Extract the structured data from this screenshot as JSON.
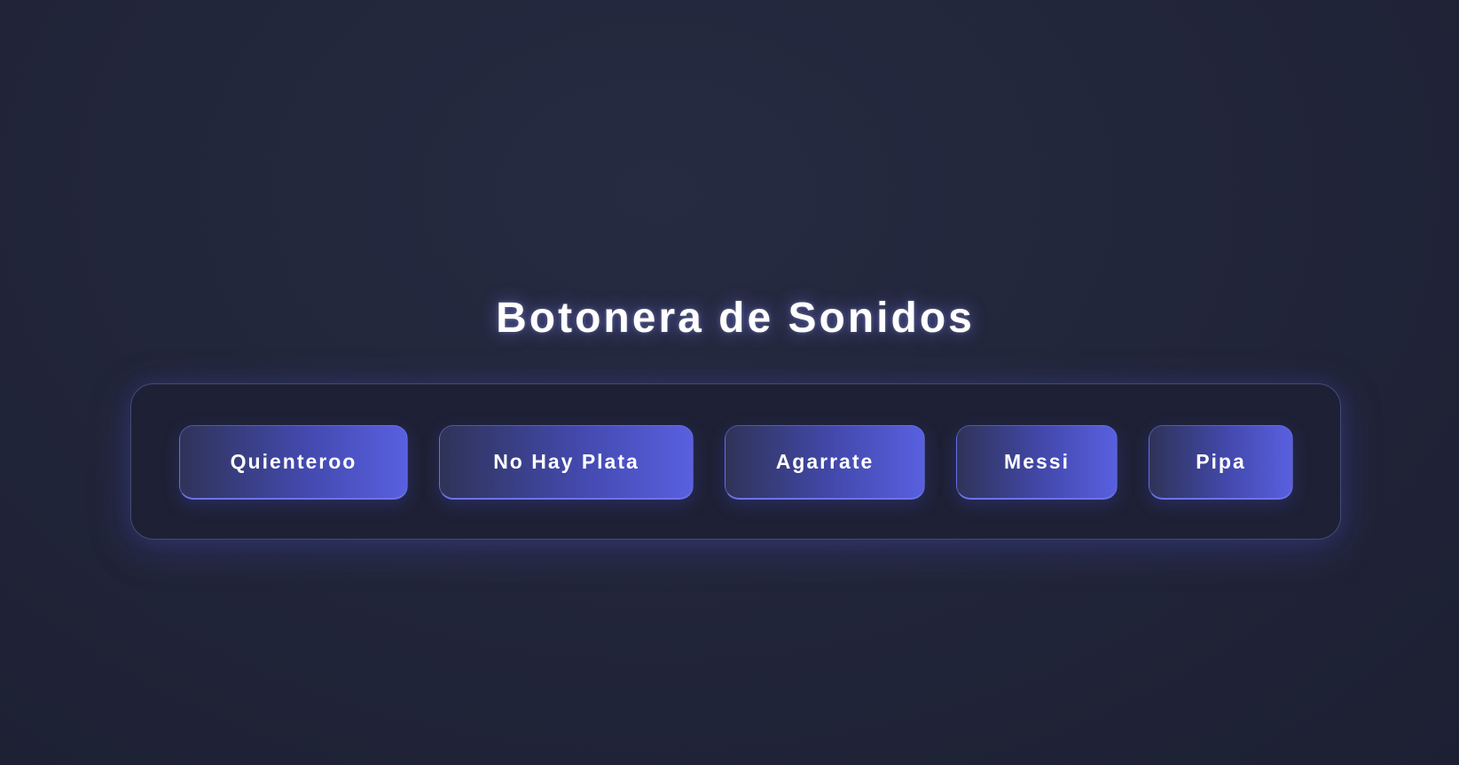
{
  "header": {
    "title": "Botonera de Sonidos"
  },
  "soundboard": {
    "buttons": [
      {
        "label": "Quienteroo"
      },
      {
        "label": "No Hay Plata"
      },
      {
        "label": "Agarrate"
      },
      {
        "label": "Messi"
      },
      {
        "label": "Pipa"
      }
    ]
  },
  "colors": {
    "background": "#22263a",
    "panel": "#1e2135",
    "panel_border": "#454a72",
    "button_gradient_start": "#2f3358",
    "button_gradient_end": "#5960e0",
    "text": "#ffffff"
  }
}
